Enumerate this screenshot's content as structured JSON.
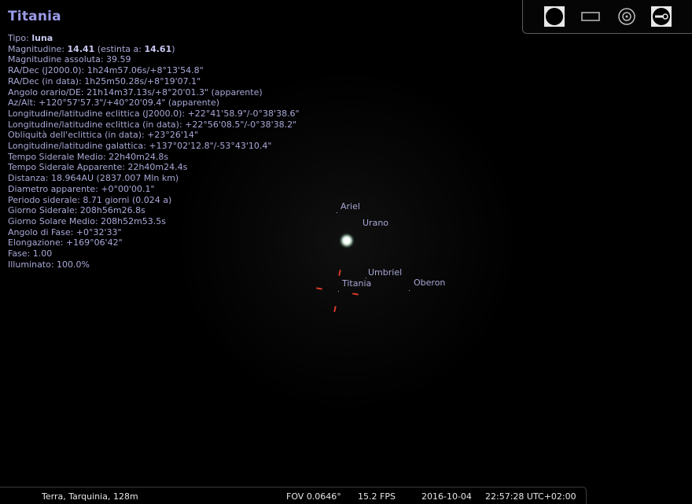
{
  "object": {
    "title": "Titania"
  },
  "info": [
    {
      "label": "Tipo: ",
      "bold": "luna",
      "rest": ""
    },
    {
      "label": "Magnitudine: ",
      "bold": "14.41",
      "rest": " (estinta a: ",
      "bold2": "14.61",
      "rest2": ")"
    },
    {
      "label": "Magnitudine assoluta: 39.59"
    },
    {
      "label": "RA/Dec (J2000.0): 1h24m57.06s/+8°13'54.8\""
    },
    {
      "label": "RA/Dec (in data): 1h25m50.28s/+8°19'07.1\""
    },
    {
      "label": "Angolo orario/DE: 21h14m37.13s/+8°20'01.3\" (apparente)"
    },
    {
      "label": "Az/Alt: +120°57'57.3\"/+40°20'09.4\" (apparente)"
    },
    {
      "label": "Longitudine/latitudine eclittica (J2000.0): +22°41'58.9\"/-0°38'38.6\""
    },
    {
      "label": "Longitudine/latitudine eclittica (in data): +22°56'08.5\"/-0°38'38.2\""
    },
    {
      "label": "Obliquità dell'eclittica (in data): +23°26'14\""
    },
    {
      "label": "Longitudine/latitudine galattica: +137°02'12.8\"/-53°43'10.4\""
    },
    {
      "label": "Tempo Siderale Medio: 22h40m24.8s"
    },
    {
      "label": "Tempo Siderale Apparente: 22h40m24.4s"
    },
    {
      "label": "Distanza: 18.964AU (2837.007 Mln km)"
    },
    {
      "label": "Diametro apparente: +0°00'00.1\""
    },
    {
      "label": "Periodo siderale: 8.71 giorni (0.024 a)"
    },
    {
      "label": "Giorno Siderale: 208h56m26.8s"
    },
    {
      "label": "Giorno Solare Medio: 208h52m53.5s"
    },
    {
      "label": "Angolo di Fase: +0°32'33\""
    },
    {
      "label": "Elongazione: +169°06'42\""
    },
    {
      "label": "Fase: 1.00"
    },
    {
      "label": "Illuminato: 100.0%"
    }
  ],
  "sky_labels": {
    "ariel": "Ariel",
    "urano": "Urano",
    "umbriel": "Umbriel",
    "titania": "Titania",
    "oberon": "Oberon"
  },
  "toolbar": {
    "icons": [
      "planet-disk-icon",
      "frame-rectangle-icon",
      "target-circle-icon",
      "satellite-icon"
    ]
  },
  "status": {
    "location": "Terra, Tarquinia, 128m",
    "fov": "FOV 0.0646°",
    "fps": "15.2 FPS",
    "date": "2016-10-04",
    "time": "22:57:28 UTC+02:00"
  },
  "colors": {
    "title": "#9a9be8",
    "text": "#a8a8d8",
    "pointer": "#d83a2a",
    "background": "#000000"
  }
}
